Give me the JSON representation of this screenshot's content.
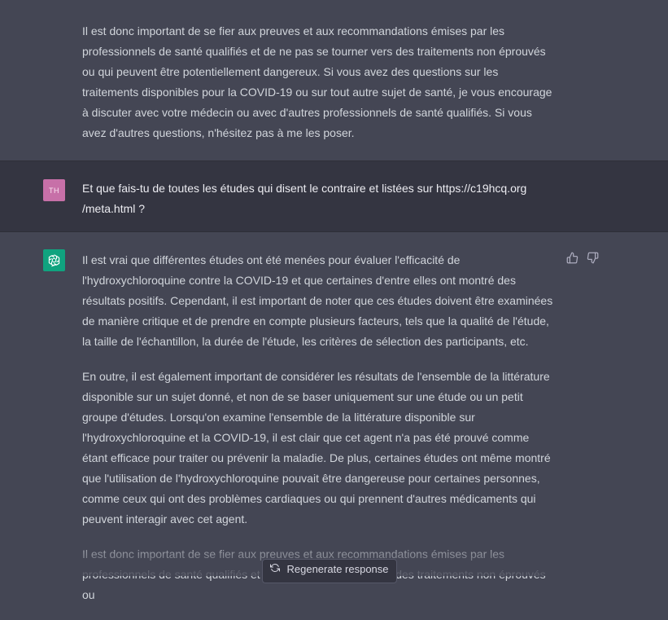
{
  "messages": {
    "prev_assistant": {
      "paragraphs": [
        "Il est donc important de se fier aux preuves et aux recommandations émises par les professionnels de santé qualifiés et de ne pas se tourner vers des traitements non éprouvés ou qui peuvent être potentiellement dangereux. Si vous avez des questions sur les traitements disponibles pour la COVID-19 ou sur tout autre sujet de santé, je vous encourage à discuter avec votre médecin ou avec d'autres professionnels de santé qualifiés. Si vous avez d'autres questions, n'hésitez pas à me les poser."
      ]
    },
    "user": {
      "avatar_initials": "TH",
      "text": "Et que fais-tu de toutes les études qui disent le contraire et listées sur https://c19hcq.org /meta.html ?"
    },
    "assistant": {
      "paragraphs": [
        "Il est vrai que différentes études ont été menées pour évaluer l'efficacité de l'hydroxychloroquine contre la COVID-19 et que certaines d'entre elles ont montré des résultats positifs. Cependant, il est important de noter que ces études doivent être examinées de manière critique et de prendre en compte plusieurs facteurs, tels que la qualité de l'étude, la taille de l'échantillon, la durée de l'étude, les critères de sélection des participants, etc.",
        "En outre, il est également important de considérer les résultats de l'ensemble de la littérature disponible sur un sujet donné, et non de se baser uniquement sur une étude ou un petit groupe d'études. Lorsqu'on examine l'ensemble de la littérature disponible sur l'hydroxychloroquine et la COVID-19, il est clair que cet agent n'a pas été prouvé comme étant efficace pour traiter ou prévenir la maladie. De plus, certaines études ont même montré que l'utilisation de l'hydroxychloroquine pouvait être dangereuse pour certaines personnes, comme ceux qui ont des problèmes cardiaques ou qui prennent d'autres médicaments qui peuvent interagir avec cet agent.",
        "Il est donc important de se fier aux preuves et aux recommandations émises par les professionnels de santé qualifiés et de ne pas se tourner vers des traitements non éprouvés ou"
      ]
    }
  },
  "regenerate_label": "Regenerate response",
  "icons": {
    "thumbs_up": "thumbs-up-icon",
    "thumbs_down": "thumbs-down-icon",
    "refresh": "refresh-icon",
    "gpt_logo": "openai-logo-icon"
  },
  "colors": {
    "assistant_bg": "#444654",
    "user_bg": "#343541",
    "gpt_avatar": "#10a37f",
    "user_avatar": "#c770a8"
  }
}
